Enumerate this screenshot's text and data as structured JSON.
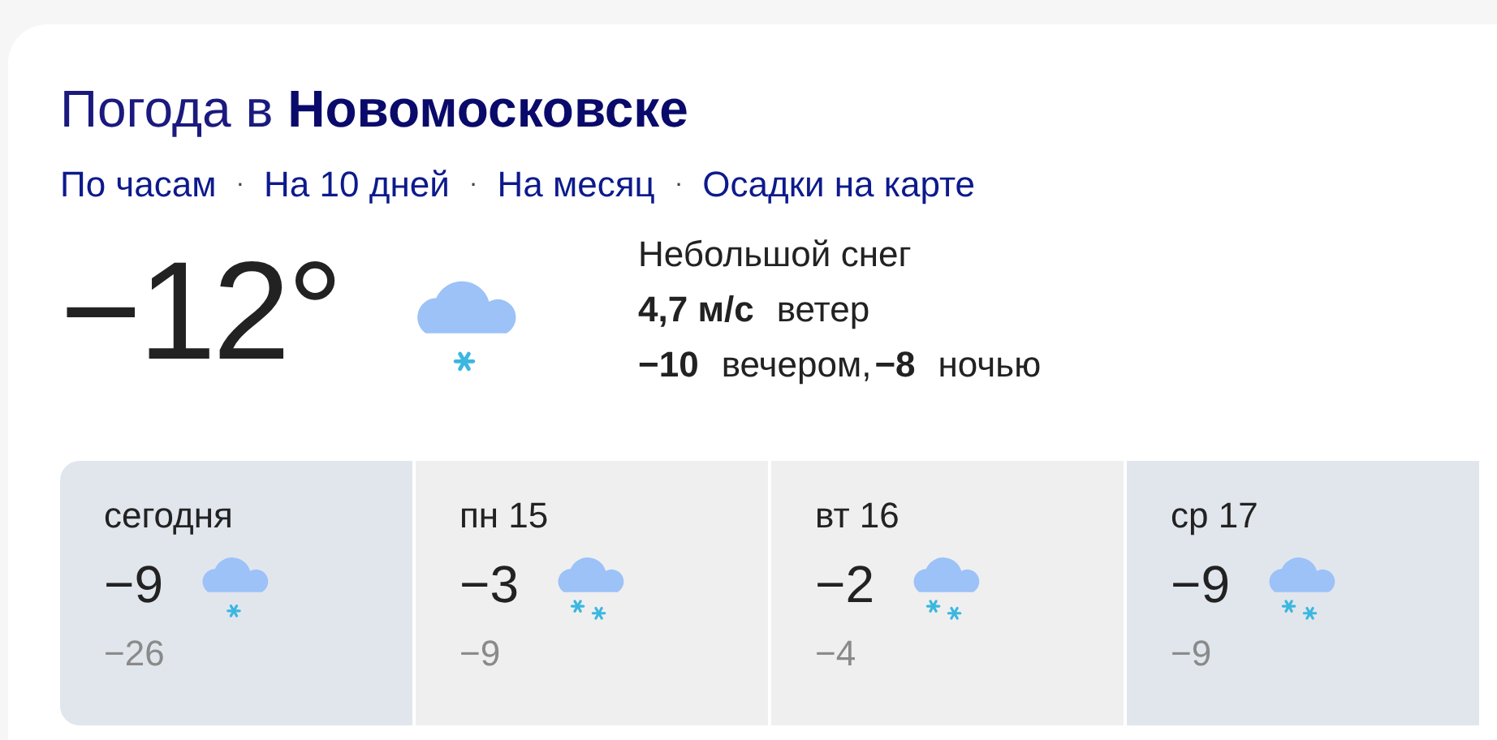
{
  "title": {
    "prefix": "Погода в",
    "city": "Новомосковске"
  },
  "links": [
    "По часам",
    "На 10 дней",
    "На месяц",
    "Осадки на карте"
  ],
  "separator": "·",
  "current": {
    "temperature": "−12°",
    "kind": "light_snow",
    "condition": "Небольшой снег",
    "wind_value": "4,7 м/с",
    "wind_label": "ветер",
    "evening_value": "−10",
    "evening_label": "вечером,",
    "night_value": "−8",
    "night_label": "ночью"
  },
  "days": [
    {
      "label": "сегодня",
      "day_temp": "−9",
      "night_temp": "−26",
      "kind": "light_snow",
      "selected": true
    },
    {
      "label": "пн 15",
      "day_temp": "−3",
      "night_temp": "−9",
      "kind": "snow",
      "selected": false
    },
    {
      "label": "вт 16",
      "day_temp": "−2",
      "night_temp": "−4",
      "kind": "snow",
      "selected": false
    },
    {
      "label": "ср 17",
      "day_temp": "−9",
      "night_temp": "−9",
      "kind": "snow",
      "selected": true
    }
  ]
}
